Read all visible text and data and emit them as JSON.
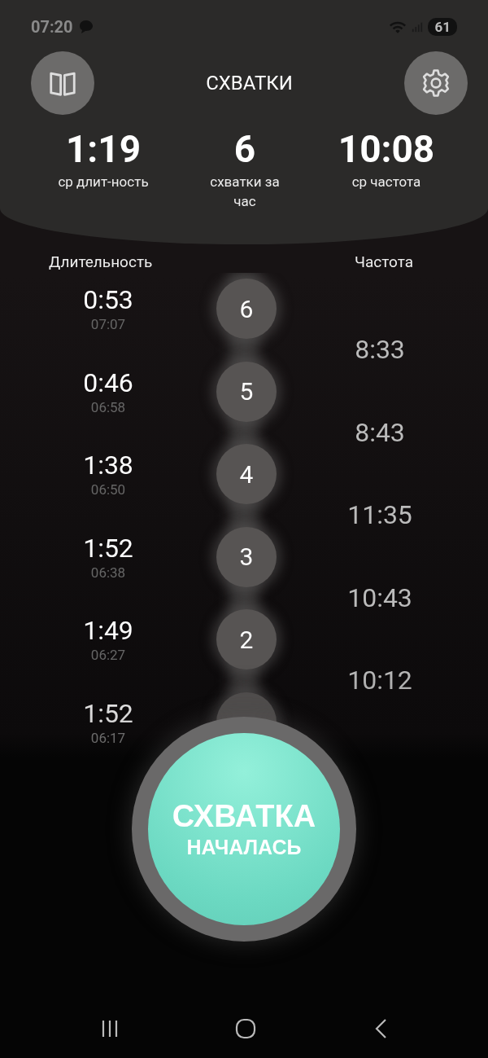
{
  "status_bar": {
    "time": "07:20",
    "battery": "61"
  },
  "header": {
    "title": "СХВАТКИ"
  },
  "stats": [
    {
      "value": "1:19",
      "label": "ср длит-ность"
    },
    {
      "value": "6",
      "label": "схватки за час"
    },
    {
      "value": "10:08",
      "label": "ср частота"
    }
  ],
  "columns": {
    "duration": "Длительность",
    "frequency": "Частота"
  },
  "contractions": [
    {
      "number": "6",
      "duration": "0:53",
      "start": "07:07",
      "frequency": "8:33"
    },
    {
      "number": "5",
      "duration": "0:46",
      "start": "06:58",
      "frequency": "8:43"
    },
    {
      "number": "4",
      "duration": "1:38",
      "start": "06:50",
      "frequency": "11:35"
    },
    {
      "number": "3",
      "duration": "1:52",
      "start": "06:38",
      "frequency": "10:43"
    },
    {
      "number": "2",
      "duration": "1:49",
      "start": "06:27",
      "frequency": "10:12"
    },
    {
      "duration": "1:52",
      "start": "06:17"
    }
  ],
  "main_button": {
    "line1": "СХВАТКА",
    "line2": "НАЧАЛАСЬ"
  }
}
